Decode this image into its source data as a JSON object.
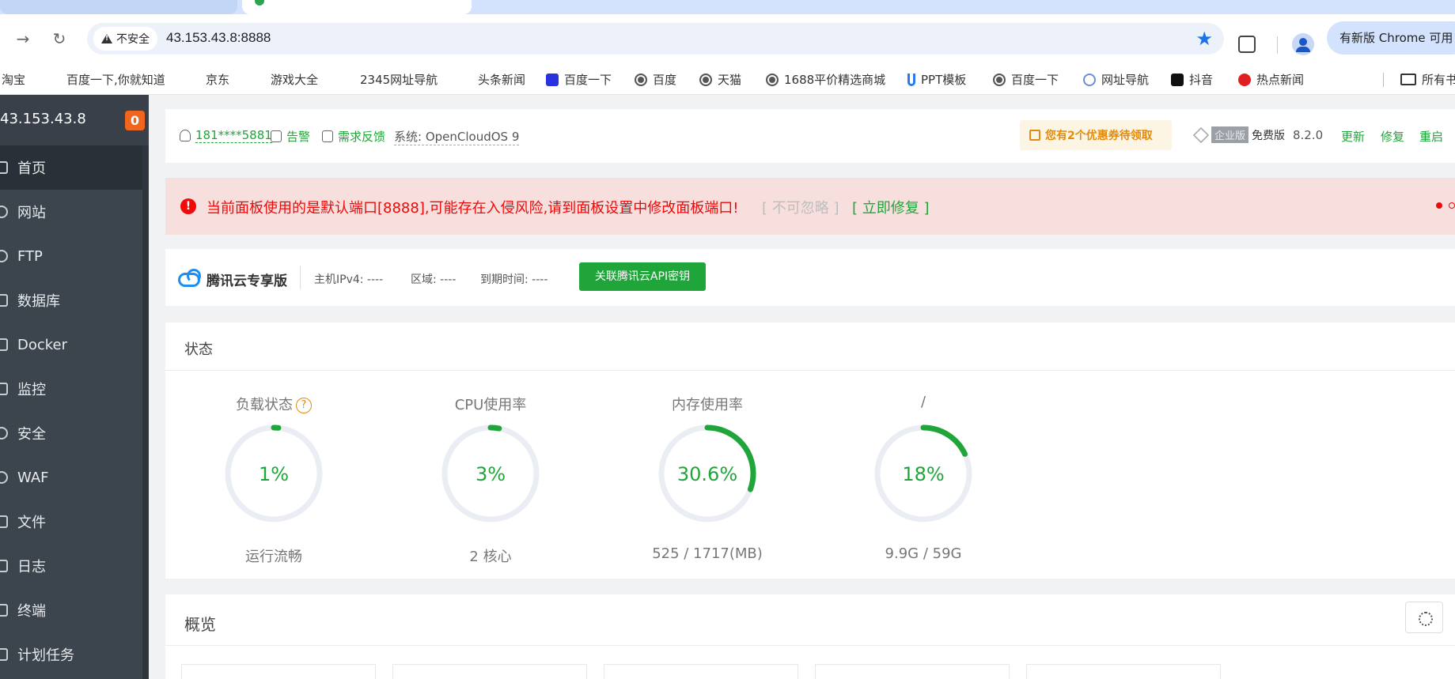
{
  "browser": {
    "address": "43.153.43.8:8888",
    "insecure_label": "不安全",
    "update_label": "有新版 Chrome 可用",
    "bookmarks": [
      "淘宝",
      "百度一下,你就知道",
      "京东",
      "游戏大全",
      "2345网址导航",
      "头条新闻",
      "百度一下",
      "百度",
      "天猫",
      "1688平价精选商城",
      "PPT模板",
      "百度一下",
      "网址导航",
      "抖音",
      "热点新闻",
      "所有书签"
    ]
  },
  "sidebar": {
    "host": "43.153.43.8",
    "badge": "0",
    "items": [
      {
        "label": "首页",
        "icon": "home-icon"
      },
      {
        "label": "网站",
        "icon": "globe-icon"
      },
      {
        "label": "FTP",
        "icon": "ftp-icon"
      },
      {
        "label": "数据库",
        "icon": "database-icon"
      },
      {
        "label": "Docker",
        "icon": "docker-icon"
      },
      {
        "label": "监控",
        "icon": "monitor-icon"
      },
      {
        "label": "安全",
        "icon": "shield-icon"
      },
      {
        "label": "WAF",
        "icon": "waf-icon"
      },
      {
        "label": "文件",
        "icon": "folder-icon"
      },
      {
        "label": "日志",
        "icon": "log-icon"
      },
      {
        "label": "终端",
        "icon": "terminal-icon"
      },
      {
        "label": "计划任务",
        "icon": "calendar-icon"
      }
    ]
  },
  "topbar": {
    "user": "181****5881",
    "alarm": "告警",
    "feedback": "需求反馈",
    "system": "系统: OpenCloudOS 9",
    "coupon": "您有2个优惠券待领取",
    "enterprise": "企业版",
    "free": "免费版",
    "version": "8.2.0",
    "update": "更新",
    "repair": "修复",
    "restart": "重启"
  },
  "alert": {
    "text": "当前面板使用的是默认端口[8888],可能存在入侵风险,请到面板设置中修改面板端口!",
    "ignore": "[ 不可忽略 ]",
    "fix": "[ 立即修复 ]"
  },
  "cloud": {
    "brand": "腾讯云专享版",
    "ipv4": "主机IPv4: ----",
    "region": "区域: ----",
    "expire": "到期时间: ----",
    "button": "关联腾讯云API密钥"
  },
  "status": {
    "title": "状态",
    "gauges": [
      {
        "label": "负载状态",
        "value": "1%",
        "percent": 1,
        "sub": "运行流畅",
        "help": "?"
      },
      {
        "label": "CPU使用率",
        "value": "3%",
        "percent": 3,
        "sub": "2 核心"
      },
      {
        "label": "内存使用率",
        "value": "30.6%",
        "percent": 30.6,
        "sub": "525 / 1717(MB)"
      },
      {
        "label": "/",
        "value": "18%",
        "percent": 18,
        "sub": "9.9G / 59G"
      }
    ]
  },
  "overview": {
    "title": "概览"
  },
  "colors": {
    "accent": "#20a53a",
    "danger": "#ef0b0b",
    "sidebar_bg": "#3c444d",
    "ring_track": "#eaedf3"
  }
}
